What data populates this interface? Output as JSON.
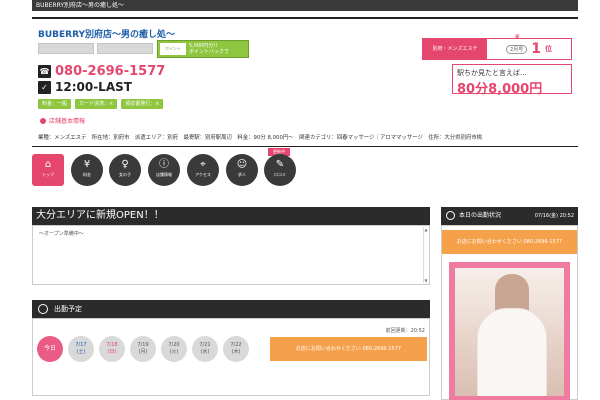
{
  "header": {
    "breadcrumb": "BUBERRY別府店〜男の癒し処〜",
    "shop_name": "BUBERRY別府店〜男の癒し処〜",
    "banner_line1": "5,000円分!!",
    "banner_line2": "ポイントバックで",
    "banner_small": "ポイント",
    "phone": "080-2696-1577",
    "hours": "12:00-LAST",
    "tags": [
      "料金：一般",
      "カード決済：×",
      "領収書発行：×"
    ],
    "basic_info_link": "店舗基本情報",
    "info_row": "業種：メンズエステ　所在地：別府市　派遣エリア：別府　最寄駅：別府駅周辺　料金：90分 8,000円〜　関連カテゴリ：回春マッサージ｜アロママッサージ　住所：大分県別府市桃"
  },
  "rank": {
    "label": "別府・メンズエステ",
    "sub": "2月号",
    "value": "1",
    "unit": "位"
  },
  "price": {
    "title": "駅ちか見たと言えば...",
    "amount": "80分8,000円"
  },
  "nav": {
    "updated_badge": "更新中",
    "items": [
      {
        "label": "トップ",
        "icon": "home-icon",
        "glyph": "⌂"
      },
      {
        "label": "料金",
        "icon": "yen-icon",
        "glyph": "¥"
      },
      {
        "label": "女の子",
        "icon": "woman-icon",
        "glyph": "♀"
      },
      {
        "label": "店舗情報",
        "icon": "info-icon",
        "glyph": "i"
      },
      {
        "label": "アクセス",
        "icon": "pin-icon",
        "glyph": "⌖"
      },
      {
        "label": "求人",
        "icon": "person-icon",
        "glyph": "☺"
      },
      {
        "label": "口コミ",
        "icon": "edit-icon",
        "glyph": "✎"
      }
    ]
  },
  "open_notice": {
    "title": "大分エリアに新規OPEN！！",
    "body": "〜オープン準備中〜"
  },
  "schedule": {
    "title": "出勤予定",
    "updated": "前回更新：20:52",
    "today_label": "今日",
    "days": [
      {
        "date": "7/17",
        "wk": "(土)"
      },
      {
        "date": "7/18",
        "wk": "(日)"
      },
      {
        "date": "7/19",
        "wk": "(月)"
      },
      {
        "date": "7/20",
        "wk": "(火)"
      },
      {
        "date": "7/21",
        "wk": "(水)"
      },
      {
        "date": "7/22",
        "wk": "(木)"
      }
    ],
    "cta": "お店にお問い合わせください 080-2696-1577"
  },
  "today": {
    "title": "本日の出勤状況",
    "date": "07/16(金) 20:52",
    "cta": "お店にお問い合わせください 080-2696-1577"
  },
  "colors": {
    "accent_pink": "#e5466e",
    "green": "#8ec63f",
    "orange": "#f5a04a",
    "dark": "#2b2b2b"
  }
}
